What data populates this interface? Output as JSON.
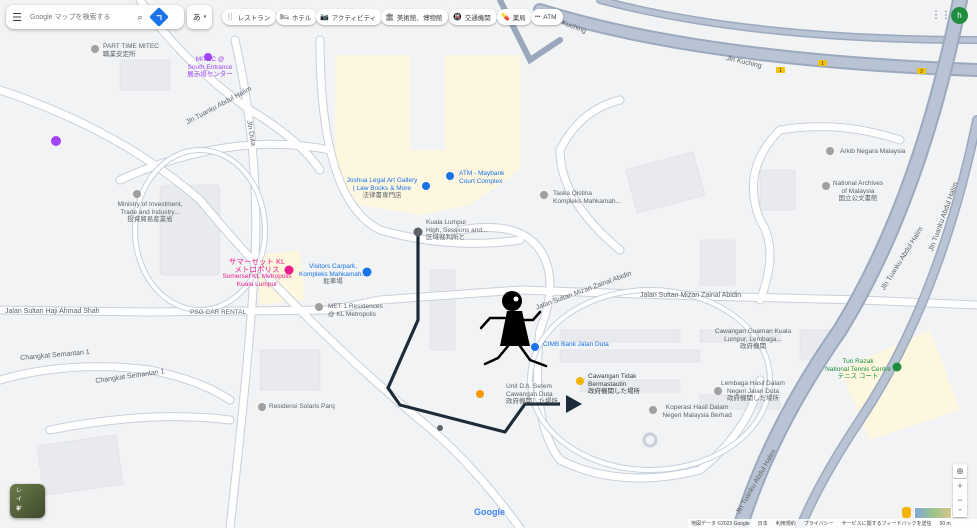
{
  "search": {
    "placeholder": "Google マップを検索する",
    "menu_icon": "hamburger-icon",
    "search_icon": "magnifier-icon",
    "directions_icon": "directions-icon"
  },
  "ime": {
    "label": "あ"
  },
  "chips": [
    {
      "icon": "🍴",
      "label": "レストラン"
    },
    {
      "icon": "🛏",
      "label": "ホテル"
    },
    {
      "icon": "📷",
      "label": "アクティビティ"
    },
    {
      "icon": "🏛",
      "label": "美術館、博物館"
    },
    {
      "icon": "🚇",
      "label": "交通機関"
    },
    {
      "icon": "💊",
      "label": "薬局"
    },
    {
      "icon": "•••",
      "label": "ATM"
    }
  ],
  "account": {
    "initial": "h"
  },
  "places": {
    "part_time": {
      "name": "PART TIME MITEC",
      "sub": "職業安定所"
    },
    "mitec": {
      "name": "MITEC @",
      "name2": "South Entrance",
      "sub": "展示場センター"
    },
    "ministry": {
      "line1": "Ministry of Investment,",
      "line2": "Trade and Industry...",
      "line3": "投資貿易産業省"
    },
    "joshua": {
      "line1": "Joshua Legal Art Gallery",
      "line2": "| Law Books & More",
      "sub": "法律書専門店"
    },
    "atm_maybank": {
      "line1": "ATM - Maybank",
      "line2": "Court Complex"
    },
    "taska": {
      "line1": "Taska Qistina",
      "line2": "Kompleks Mahkamah..."
    },
    "kl_high": {
      "line1": "Kuala Lumpur",
      "line2": "High, Sessions and...",
      "sub": "区域裁判所と"
    },
    "summerset": {
      "line1": "サマーセット KL",
      "line2": "メトロポリス",
      "line3": "Somerset KL Metropolis",
      "line4": "Kuala Lumpur"
    },
    "visitors": {
      "line1": "Visitors Carpark,",
      "line2": "Kompleks Mahkamah...",
      "sub": "駐車場"
    },
    "met1": {
      "line1": "MET 1 Residences",
      "line2": "@ KL Metropolis"
    },
    "psg": {
      "name": "PSG CAR RENTAL"
    },
    "cimb": {
      "name": "CIMB Bank Jalan Duta"
    },
    "cawangan_guaman": {
      "line1": "Cawangan Guaman Kuala",
      "line2": "Lumpur, Lembaga...",
      "sub": "政府機関"
    },
    "cawangan_tidak": {
      "line1": "Cawangan Tidak",
      "line2": "Bermastautin",
      "sub": "政府機関した場所"
    },
    "unit": {
      "line1": "Unit D.h. Setem",
      "line2": "Cawangan Duta",
      "sub": "政府機関した場所"
    },
    "lembaga": {
      "line1": "Lembaga Hasil Dalam",
      "line2": "Negeri Jalan Duta",
      "sub": "政府機関した場所"
    },
    "koperasi": {
      "line1": "Koperasi Hasil Dalam",
      "line2": "Negeri Malaysia Berhad"
    },
    "arkib": {
      "name": "Arkib Negara Malaysia"
    },
    "national_archives": {
      "line1": "National Archives",
      "line2": "of Malaysia",
      "sub": "国立公文書館"
    },
    "tun_razak": {
      "line1": "Tun Razak",
      "line2": "National Tennis Centre",
      "sub": "テニス コート"
    },
    "residensi": {
      "name": "Residensi Solaris Parq"
    }
  },
  "roads": {
    "jln_kuching_1": "Jln Kuching",
    "jln_kuching_2": "Jln Kuching",
    "jln_tuanku_1": "Jln Tuanku Abdul Halim",
    "jln_tuanku_2": "Jln Tuanku Abdul Halim",
    "jln_tuanku_3": "Jln Tuanku Abdul Halim",
    "jln_sultan_mizan_1": "Jalan Sultan Mizan Zainal Abidin",
    "jln_sultan_mizan_2": "Jalan Sultan Mizan Zainal Abidin",
    "jln_sultan_haji": "Jalan Sultan Haji Ahmad Shah",
    "jln_kiara": "Jln Tuanku Abdul Halim",
    "jln_duta": "Jln Duta",
    "changkat_1": "Changkat Semantan 1",
    "changkat_2": "Changkat Semantan 1"
  },
  "layers": {
    "label": "レイヤ"
  },
  "footer": {
    "items": [
      "地図データ ©2023 Google",
      "日本",
      "利用規約",
      "プライバシー",
      "サービスに関するフィードバックを送信",
      "50 m"
    ]
  },
  "google": {
    "logo": "Google"
  },
  "colors": {
    "road": "#ffffff",
    "road_edge": "#c7d0db",
    "highway": "#9aa9bd",
    "building": "#e8eaed",
    "poi_area": "#fef7e0",
    "route": "#1c2b3a",
    "land": "#f1f3f4"
  }
}
